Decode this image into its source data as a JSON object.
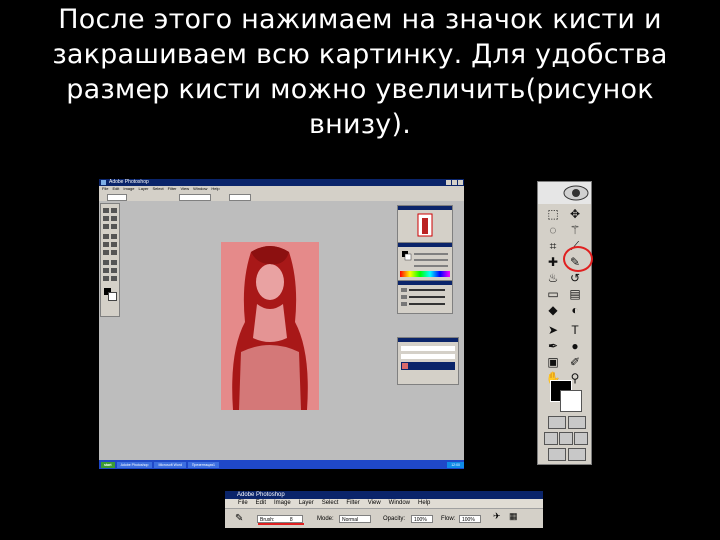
{
  "caption": {
    "line1": "После этого нажимаем на значок кисти и",
    "line2": "закрашиваем всю картинку. Для удобства",
    "line3": "размер кисти можно увеличить(рисунок",
    "line4": "внизу)."
  },
  "screenshot": {
    "title": "Adobe Photoshop",
    "menu": [
      "File",
      "Edit",
      "Image",
      "Layer",
      "Select",
      "Filter",
      "View",
      "Window",
      "Help"
    ],
    "taskbar": {
      "start": "start",
      "tasks": [
        "Adobe Photoshop",
        "Microsoft Word",
        "Презентация1"
      ],
      "clock": "12:00"
    }
  },
  "toolbox": {
    "tools": [
      {
        "icon": "marquee-icon",
        "glyph": "⬚"
      },
      {
        "icon": "move-icon",
        "glyph": "✥"
      },
      {
        "icon": "lasso-icon",
        "glyph": "◌"
      },
      {
        "icon": "magic-wand-icon",
        "glyph": "⚚"
      },
      {
        "icon": "crop-icon",
        "glyph": "⌗"
      },
      {
        "icon": "slice-icon",
        "glyph": "⟋"
      },
      {
        "icon": "healing-brush-icon",
        "glyph": "✚"
      },
      {
        "icon": "brush-icon",
        "glyph": "✎"
      },
      {
        "icon": "clone-stamp-icon",
        "glyph": "♨"
      },
      {
        "icon": "history-brush-icon",
        "glyph": "↺"
      },
      {
        "icon": "eraser-icon",
        "glyph": "▭"
      },
      {
        "icon": "gradient-icon",
        "glyph": "▤"
      },
      {
        "icon": "blur-icon",
        "glyph": "◆"
      },
      {
        "icon": "dodge-icon",
        "glyph": "◐"
      },
      {
        "icon": "path-select-icon",
        "glyph": "➤"
      },
      {
        "icon": "type-icon",
        "glyph": "T"
      },
      {
        "icon": "pen-icon",
        "glyph": "✒"
      },
      {
        "icon": "shape-icon",
        "glyph": "●"
      },
      {
        "icon": "notes-icon",
        "glyph": "▣"
      },
      {
        "icon": "eyedropper-icon",
        "glyph": "✐"
      },
      {
        "icon": "hand-icon",
        "glyph": "✋"
      },
      {
        "icon": "zoom-icon",
        "glyph": "⚲"
      }
    ],
    "foreground_color": "#000000",
    "background_color": "#ffffff"
  },
  "options_strip": {
    "title": "Adobe Photoshop",
    "menu": [
      "File",
      "Edit",
      "Image",
      "Layer",
      "Select",
      "Filter",
      "View",
      "Window",
      "Help"
    ],
    "brush_label": "Brush:",
    "brush_size": "8",
    "mode_label": "Mode:",
    "mode_value": "Normal",
    "opacity_label": "Opacity:",
    "opacity_value": "100%",
    "flow_label": "Flow:",
    "flow_value": "100%"
  },
  "colors": {
    "highlight": "#e02020",
    "photo_tint": "#d86a6a",
    "titlebar": "#0a246a"
  }
}
